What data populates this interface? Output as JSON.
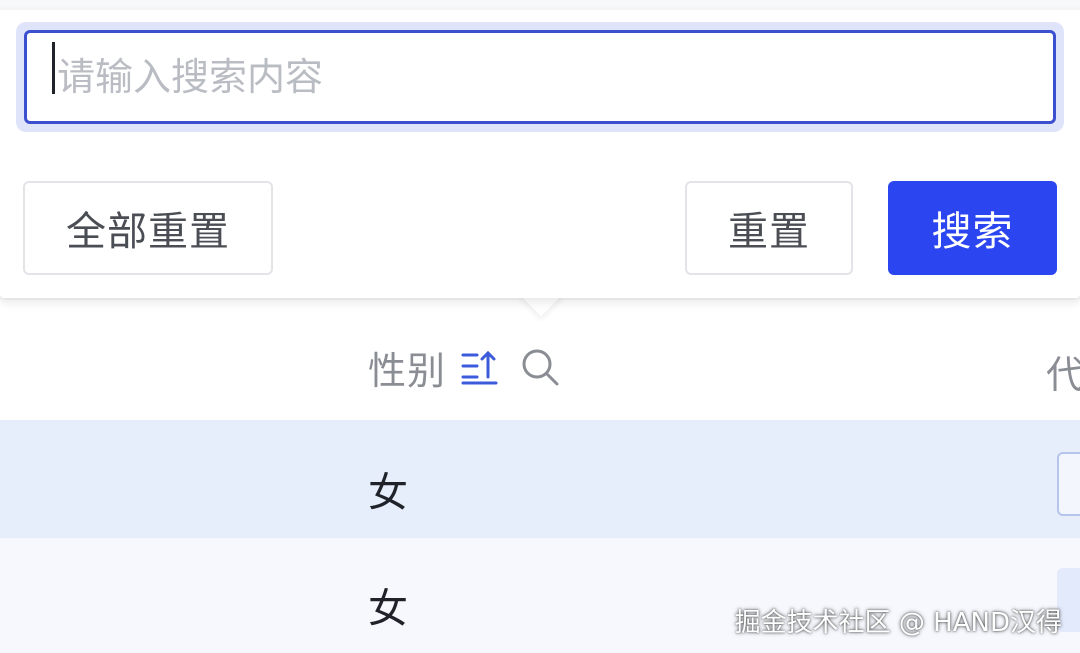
{
  "filter": {
    "search_placeholder": "请输入搜索内容",
    "search_value": "",
    "reset_all_label": "全部重置",
    "reset_label": "重置",
    "search_label": "搜索"
  },
  "table": {
    "columns": [
      {
        "label": "性别",
        "sort_icon": "sort-ascending-icon",
        "filter_icon": "search-icon"
      },
      {
        "label": "代"
      }
    ],
    "rows": [
      {
        "gender": "女"
      },
      {
        "gender": "女"
      }
    ]
  },
  "watermark": "掘金技术社区 @ HAND汉得",
  "colors": {
    "primary": "#2b45f0",
    "input_border": "#3b4fcf",
    "row_selected": "#e6eefc",
    "row_alt": "#f6f8fd",
    "sort_icon": "#3b5bdb"
  }
}
